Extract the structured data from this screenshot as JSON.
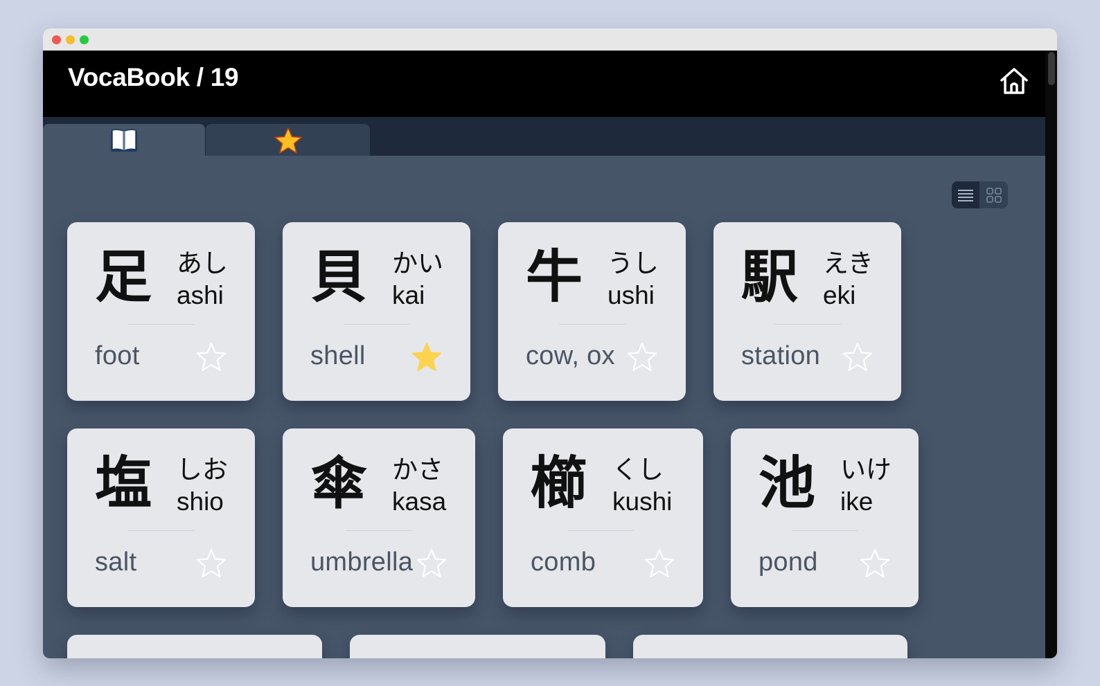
{
  "app": {
    "title": "VocaBook / 19"
  },
  "tabs": [
    {
      "icon": "open-book-icon",
      "active": true
    },
    {
      "icon": "star-icon",
      "active": false
    }
  ],
  "view_toggle": {
    "options": [
      "list-view-icon",
      "grid-view-icon"
    ]
  },
  "colors": {
    "header_bg": "#000000",
    "tabstrip_bg": "#1e293b",
    "content_bg": "#475569",
    "card_bg": "#e5e7eb",
    "star_filled": "#fcd34d",
    "star_empty": "#ffffff"
  },
  "cards": [
    {
      "kanji": "足",
      "kana": "あし",
      "romaji": "ashi",
      "meaning": "foot",
      "starred": false
    },
    {
      "kanji": "貝",
      "kana": "かい",
      "romaji": "kai",
      "meaning": "shell",
      "starred": true
    },
    {
      "kanji": "牛",
      "kana": "うし",
      "romaji": "ushi",
      "meaning": "cow, ox",
      "starred": false
    },
    {
      "kanji": "駅",
      "kana": "えき",
      "romaji": "eki",
      "meaning": "station",
      "starred": false
    },
    {
      "kanji": "塩",
      "kana": "しお",
      "romaji": "shio",
      "meaning": "salt",
      "starred": false
    },
    {
      "kanji": "傘",
      "kana": "かさ",
      "romaji": "kasa",
      "meaning": "umbrella",
      "starred": false
    },
    {
      "kanji": "櫛",
      "kana": "くし",
      "romaji": "kushi",
      "meaning": "comb",
      "starred": false
    },
    {
      "kanji": "池",
      "kana": "いけ",
      "romaji": "ike",
      "meaning": "pond",
      "starred": false
    }
  ]
}
